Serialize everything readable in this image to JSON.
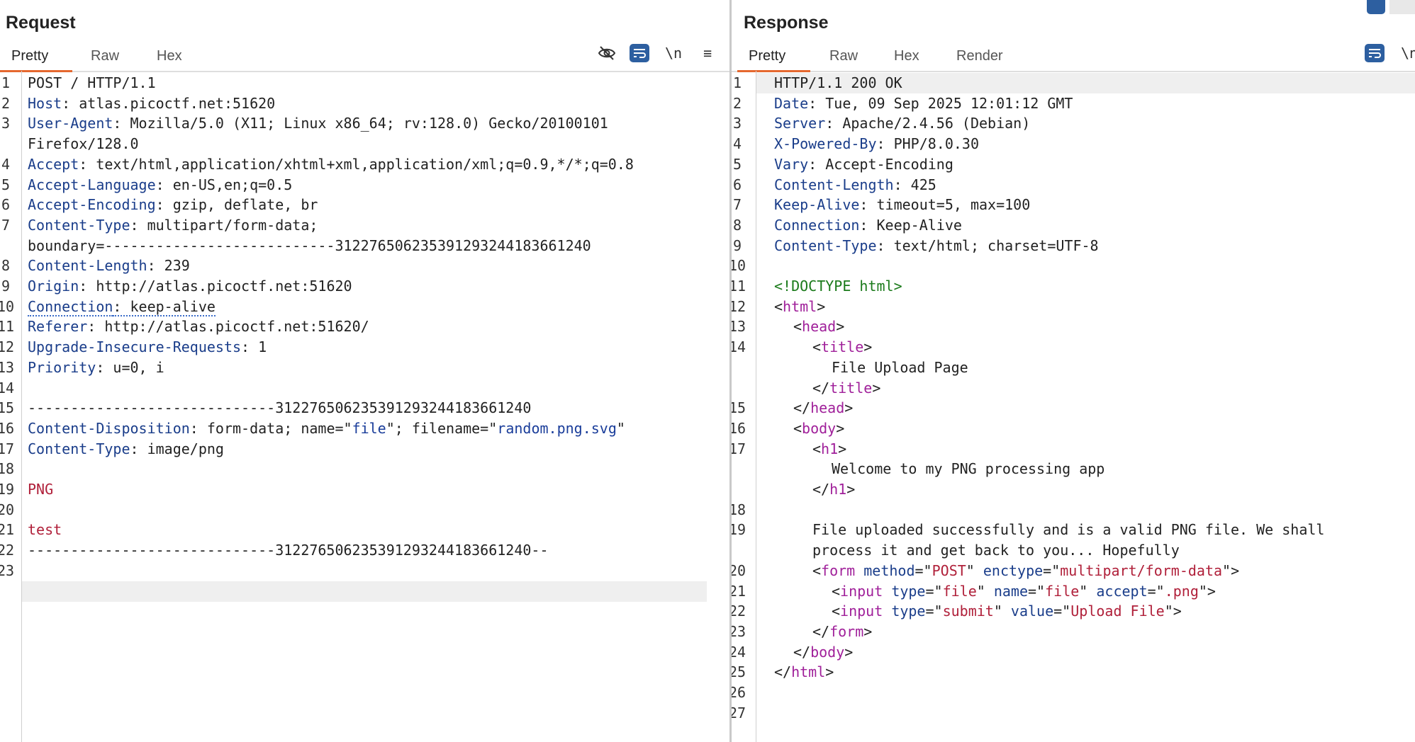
{
  "request": {
    "title": "Request",
    "tabs": [
      "Pretty",
      "Raw",
      "Hex"
    ],
    "icons": [
      "eye-off-icon",
      "wrap-lines-icon",
      "newline-icon",
      "menu-icon"
    ],
    "newline_label": "\\n",
    "menu_glyph": "≡",
    "lines": [
      {
        "n": "1",
        "parts": [
          [
            "POST / HTTP/1.1",
            ""
          ]
        ]
      },
      {
        "n": "2",
        "parts": [
          [
            "Host",
            "hk"
          ],
          [
            ": atlas.picoctf.net:51620",
            ""
          ]
        ]
      },
      {
        "n": "3",
        "parts": [
          [
            "User-Agent",
            "hk"
          ],
          [
            ": Mozilla/5.0 (X11; Linux x86_64; rv:128.0) Gecko/20100101",
            ""
          ]
        ]
      },
      {
        "n": "",
        "parts": [
          [
            "Firefox/128.0",
            ""
          ]
        ]
      },
      {
        "n": "4",
        "parts": [
          [
            "Accept",
            "hk"
          ],
          [
            ": text/html,application/xhtml+xml,application/xml;q=0.9,*/*;q=0.8",
            ""
          ]
        ]
      },
      {
        "n": "5",
        "parts": [
          [
            "Accept-Language",
            "hk"
          ],
          [
            ": en-US,en;q=0.5",
            ""
          ]
        ]
      },
      {
        "n": "6",
        "parts": [
          [
            "Accept-Encoding",
            "hk"
          ],
          [
            ": gzip, deflate, br",
            ""
          ]
        ]
      },
      {
        "n": "7",
        "parts": [
          [
            "Content-Type",
            "hk"
          ],
          [
            ": multipart/form-data;",
            ""
          ]
        ]
      },
      {
        "n": "",
        "parts": [
          [
            "boundary=---------------------------312276506235391293244183661240",
            ""
          ]
        ]
      },
      {
        "n": "8",
        "parts": [
          [
            "Content-Length",
            "hk"
          ],
          [
            ": 239",
            ""
          ]
        ]
      },
      {
        "n": "9",
        "parts": [
          [
            "Origin",
            "hk"
          ],
          [
            ": http://atlas.picoctf.net:51620",
            ""
          ]
        ]
      },
      {
        "n": "10",
        "parts": [
          [
            "Connection",
            "hk uline"
          ],
          [
            ": keep-alive",
            "uline"
          ]
        ]
      },
      {
        "n": "11",
        "parts": [
          [
            "Referer",
            "hk"
          ],
          [
            ": http://atlas.picoctf.net:51620/",
            ""
          ]
        ]
      },
      {
        "n": "12",
        "parts": [
          [
            "Upgrade-Insecure-Requests",
            "hk"
          ],
          [
            ": 1",
            ""
          ]
        ]
      },
      {
        "n": "13",
        "parts": [
          [
            "Priority",
            "hk"
          ],
          [
            ": u=0, i",
            ""
          ]
        ]
      },
      {
        "n": "14",
        "parts": []
      },
      {
        "n": "15",
        "parts": [
          [
            "-----------------------------312276506235391293244183661240",
            ""
          ]
        ]
      },
      {
        "n": "16",
        "parts": [
          [
            "Content-Disposition",
            "hk"
          ],
          [
            ": form-data; name=\"",
            ""
          ],
          [
            "file",
            "str"
          ],
          [
            "\"; filename=\"",
            ""
          ],
          [
            "random.png.svg",
            "str"
          ],
          [
            "\"",
            ""
          ]
        ]
      },
      {
        "n": "17",
        "parts": [
          [
            "Content-Type",
            "hk"
          ],
          [
            ": image/png",
            ""
          ]
        ]
      },
      {
        "n": "18",
        "parts": []
      },
      {
        "n": "19",
        "parts": [
          [
            "PNG",
            "red"
          ]
        ]
      },
      {
        "n": "20",
        "parts": []
      },
      {
        "n": "21",
        "parts": [
          [
            "test",
            "red"
          ]
        ]
      },
      {
        "n": "22",
        "parts": [
          [
            "-----------------------------312276506235391293244183661240--",
            ""
          ]
        ]
      },
      {
        "n": "23",
        "parts": []
      }
    ]
  },
  "response": {
    "title": "Response",
    "tabs": [
      "Pretty",
      "Raw",
      "Hex",
      "Render"
    ],
    "icons": [
      "wrap-lines-icon",
      "newline-icon"
    ],
    "newline_label": "\\n",
    "lines": [
      {
        "n": "1",
        "indent": 0,
        "parts": [
          [
            "HTTP/1.1 200 OK",
            ""
          ]
        ]
      },
      {
        "n": "2",
        "indent": 0,
        "parts": [
          [
            "Date",
            "hk"
          ],
          [
            ": Tue, 09 Sep 2025 12:01:12 GMT",
            ""
          ]
        ]
      },
      {
        "n": "3",
        "indent": 0,
        "parts": [
          [
            "Server",
            "hk"
          ],
          [
            ": Apache/2.4.56 (Debian)",
            ""
          ]
        ]
      },
      {
        "n": "4",
        "indent": 0,
        "parts": [
          [
            "X-Powered-By",
            "hk"
          ],
          [
            ": PHP/8.0.30",
            ""
          ]
        ]
      },
      {
        "n": "5",
        "indent": 0,
        "parts": [
          [
            "Vary",
            "hk"
          ],
          [
            ": Accept-Encoding",
            ""
          ]
        ]
      },
      {
        "n": "6",
        "indent": 0,
        "parts": [
          [
            "Content-Length",
            "hk"
          ],
          [
            ": 425",
            ""
          ]
        ]
      },
      {
        "n": "7",
        "indent": 0,
        "parts": [
          [
            "Keep-Alive",
            "hk"
          ],
          [
            ": timeout=5, max=100",
            ""
          ]
        ]
      },
      {
        "n": "8",
        "indent": 0,
        "parts": [
          [
            "Connection",
            "hk"
          ],
          [
            ": Keep-Alive",
            ""
          ]
        ]
      },
      {
        "n": "9",
        "indent": 0,
        "parts": [
          [
            "Content-Type",
            "hk"
          ],
          [
            ": text/html; charset=UTF-8",
            ""
          ]
        ]
      },
      {
        "n": "10",
        "indent": 0,
        "parts": []
      },
      {
        "n": "11",
        "indent": 0,
        "parts": [
          [
            "<!DOCTYPE html>",
            "dt"
          ]
        ]
      },
      {
        "n": "12",
        "indent": 0,
        "parts": [
          [
            "<",
            ""
          ],
          [
            "html",
            "tag"
          ],
          [
            ">",
            ""
          ]
        ]
      },
      {
        "n": "13",
        "indent": 1,
        "parts": [
          [
            "<",
            ""
          ],
          [
            "head",
            "tag"
          ],
          [
            ">",
            ""
          ]
        ]
      },
      {
        "n": "14",
        "indent": 2,
        "parts": [
          [
            "<",
            ""
          ],
          [
            "title",
            "tag"
          ],
          [
            ">",
            ""
          ]
        ]
      },
      {
        "n": "",
        "indent": 3,
        "parts": [
          [
            "File Upload Page",
            ""
          ]
        ]
      },
      {
        "n": "",
        "indent": 2,
        "parts": [
          [
            "</",
            ""
          ],
          [
            "title",
            "tag"
          ],
          [
            ">",
            ""
          ]
        ]
      },
      {
        "n": "15",
        "indent": 1,
        "parts": [
          [
            "</",
            ""
          ],
          [
            "head",
            "tag"
          ],
          [
            ">",
            ""
          ]
        ]
      },
      {
        "n": "16",
        "indent": 1,
        "parts": [
          [
            "<",
            ""
          ],
          [
            "body",
            "tag"
          ],
          [
            ">",
            ""
          ]
        ]
      },
      {
        "n": "17",
        "indent": 2,
        "parts": [
          [
            "<",
            ""
          ],
          [
            "h1",
            "tag"
          ],
          [
            ">",
            ""
          ]
        ]
      },
      {
        "n": "",
        "indent": 3,
        "parts": [
          [
            "Welcome to my PNG processing app",
            ""
          ]
        ]
      },
      {
        "n": "",
        "indent": 2,
        "parts": [
          [
            "</",
            ""
          ],
          [
            "h1",
            "tag"
          ],
          [
            ">",
            ""
          ]
        ]
      },
      {
        "n": "18",
        "indent": 0,
        "parts": []
      },
      {
        "n": "19",
        "indent": 2,
        "parts": [
          [
            "File uploaded successfully and is a valid PNG file. We shall",
            ""
          ]
        ]
      },
      {
        "n": "",
        "indent": 2,
        "parts": [
          [
            "process it and get back to you... Hopefully",
            ""
          ]
        ]
      },
      {
        "n": "20",
        "indent": 2,
        "parts": [
          [
            "<",
            ""
          ],
          [
            "form",
            "tag"
          ],
          [
            " ",
            ""
          ],
          [
            "method",
            "attr"
          ],
          [
            "=\"",
            ""
          ],
          [
            "POST",
            "aval"
          ],
          [
            "\" ",
            ""
          ],
          [
            "enctype",
            "attr"
          ],
          [
            "=\"",
            ""
          ],
          [
            "multipart/form-data",
            "aval"
          ],
          [
            "\">",
            ""
          ]
        ]
      },
      {
        "n": "21",
        "indent": 3,
        "parts": [
          [
            "<",
            ""
          ],
          [
            "input",
            "tag"
          ],
          [
            " ",
            ""
          ],
          [
            "type",
            "attr"
          ],
          [
            "=\"",
            ""
          ],
          [
            "file",
            "aval"
          ],
          [
            "\" ",
            ""
          ],
          [
            "name",
            "attr"
          ],
          [
            "=\"",
            ""
          ],
          [
            "file",
            "aval"
          ],
          [
            "\" ",
            ""
          ],
          [
            "accept",
            "attr"
          ],
          [
            "=\"",
            ""
          ],
          [
            ".png",
            "aval"
          ],
          [
            "\">",
            ""
          ]
        ]
      },
      {
        "n": "22",
        "indent": 3,
        "parts": [
          [
            "<",
            ""
          ],
          [
            "input",
            "tag"
          ],
          [
            " ",
            ""
          ],
          [
            "type",
            "attr"
          ],
          [
            "=\"",
            ""
          ],
          [
            "submit",
            "aval"
          ],
          [
            "\" ",
            ""
          ],
          [
            "value",
            "attr"
          ],
          [
            "=\"",
            ""
          ],
          [
            "Upload File",
            "aval"
          ],
          [
            "\">",
            ""
          ]
        ]
      },
      {
        "n": "23",
        "indent": 2,
        "parts": [
          [
            "</",
            ""
          ],
          [
            "form",
            "tag"
          ],
          [
            ">",
            ""
          ]
        ]
      },
      {
        "n": "24",
        "indent": 1,
        "parts": [
          [
            "</",
            ""
          ],
          [
            "body",
            "tag"
          ],
          [
            ">",
            ""
          ]
        ]
      },
      {
        "n": "25",
        "indent": 0,
        "parts": [
          [
            "</",
            ""
          ],
          [
            "html",
            "tag"
          ],
          [
            ">",
            ""
          ]
        ]
      },
      {
        "n": "26",
        "indent": 0,
        "parts": []
      },
      {
        "n": "27",
        "indent": 0,
        "parts": []
      }
    ]
  }
}
